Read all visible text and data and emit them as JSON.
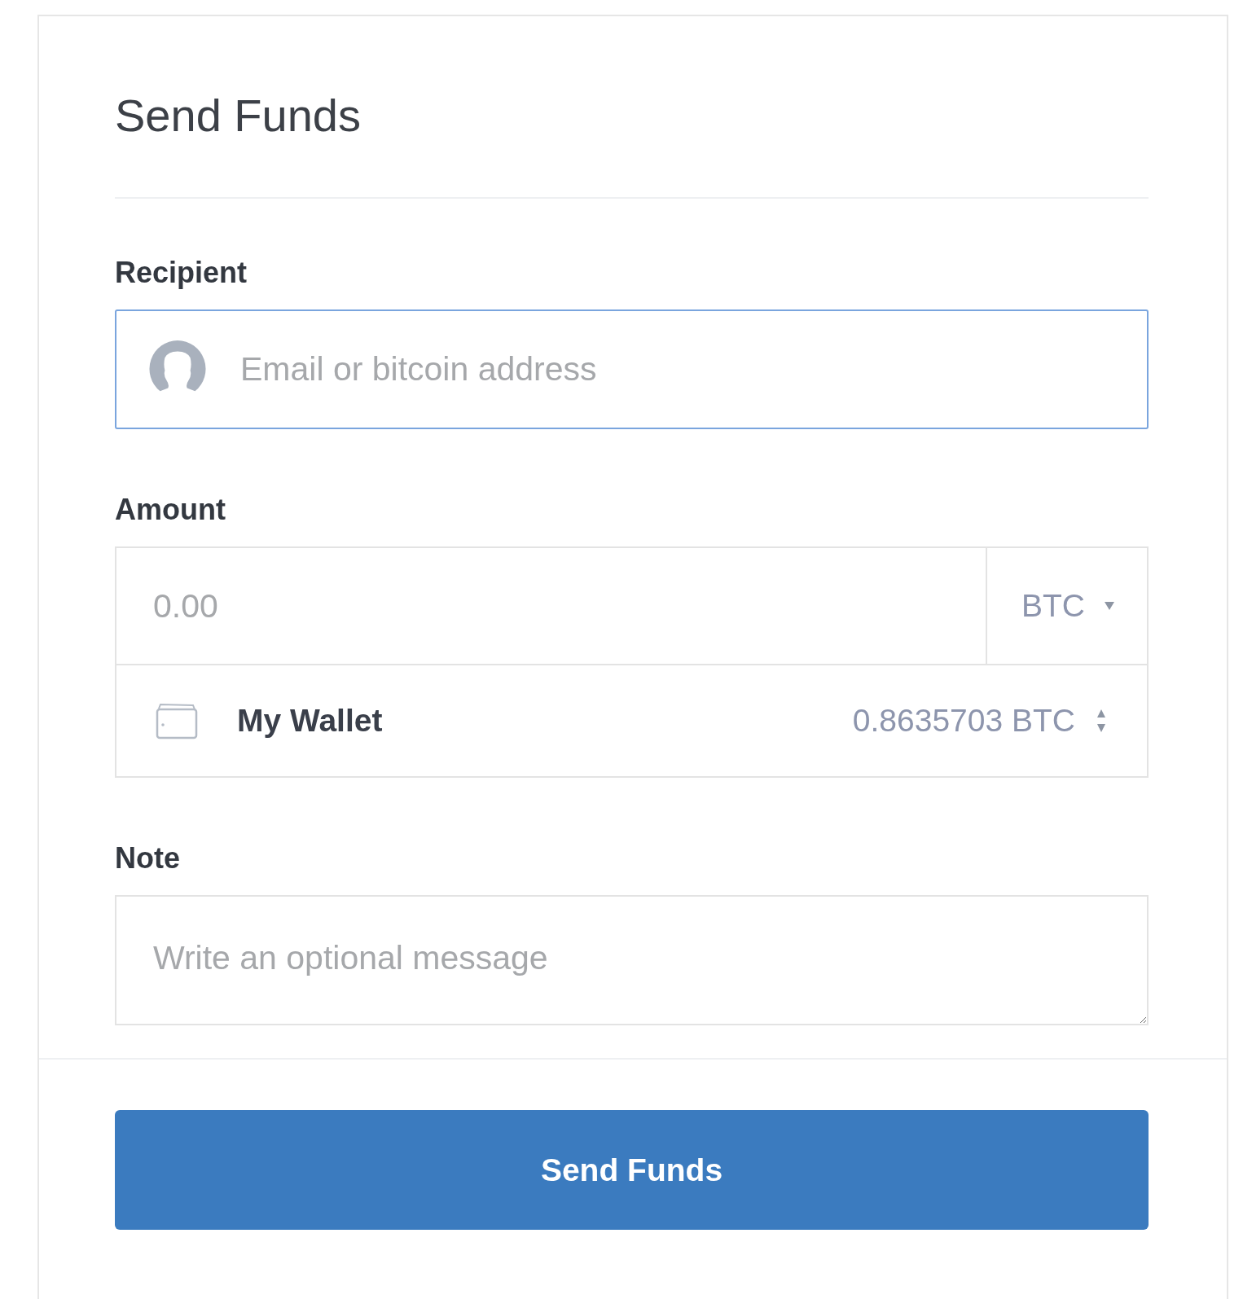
{
  "title": "Send Funds",
  "recipient": {
    "label": "Recipient",
    "placeholder": "Email or bitcoin address"
  },
  "amount": {
    "label": "Amount",
    "placeholder": "0.00",
    "currency": "BTC"
  },
  "wallet": {
    "name": "My Wallet",
    "balance": "0.8635703 BTC"
  },
  "note": {
    "label": "Note",
    "placeholder": "Write an optional message"
  },
  "submit": "Send Funds"
}
